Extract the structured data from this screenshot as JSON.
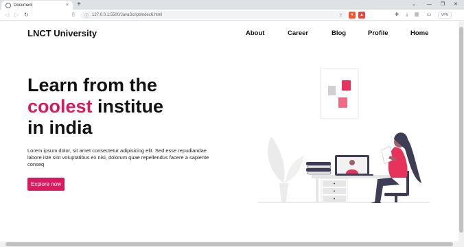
{
  "browser": {
    "tab_title": "Document",
    "tab_close": "×",
    "new_tab": "+",
    "url": "127.0.0.1:5500/JavaScript/index6.html",
    "vpn_label": "VPN",
    "window_controls": [
      "⌄",
      "—",
      "❐",
      "✕"
    ]
  },
  "navbar": {
    "logo": "LNCT University",
    "links": [
      "About",
      "Career",
      "Blog",
      "Profile",
      "Home"
    ]
  },
  "hero": {
    "line1": "Learn from the",
    "accent": "coolest",
    "line2_rest": " institue",
    "line3": "in india",
    "paragraph": "Lorem ipsum dolor, sit amet consectetur adipisicing elit. Sed esse repudiandae labore iste sint voluptatibus ex nisi, dolorum quae repellendus facere a sapiente conseq",
    "button": "Explore now"
  },
  "colors": {
    "accent": "#d81b60",
    "text": "#111111"
  },
  "icons": [
    "info-icon",
    "bookmark-icon",
    "share-icon",
    "brave-shield-icon",
    "extension-icon",
    "download-icon",
    "sidebar-icon",
    "wallet-icon"
  ]
}
